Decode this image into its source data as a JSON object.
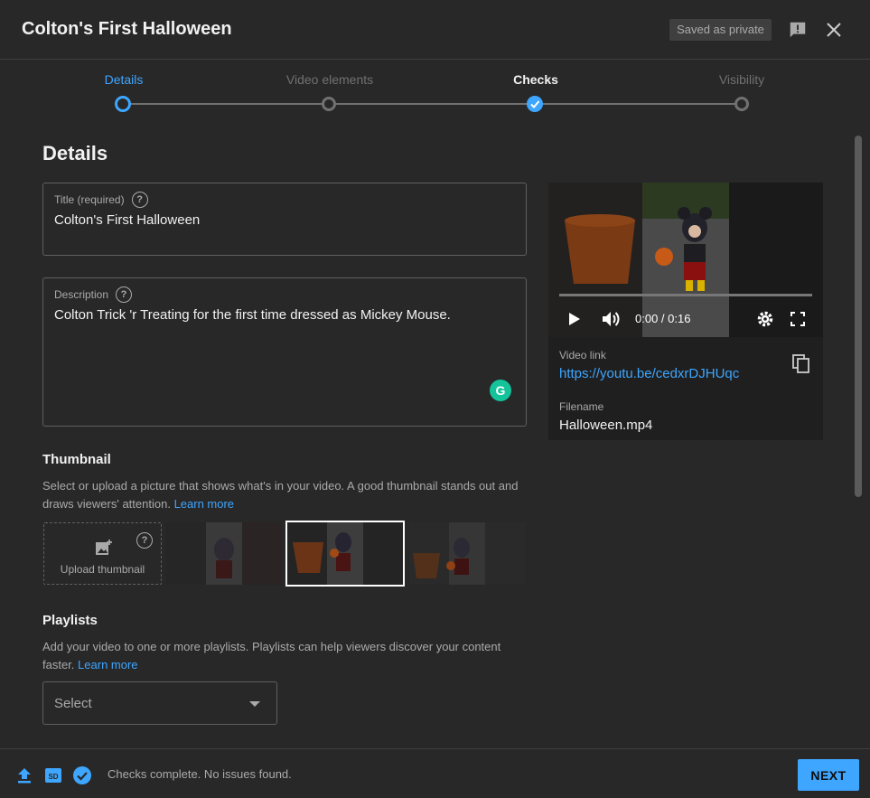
{
  "header": {
    "title": "Colton's First Halloween",
    "saved_badge": "Saved as private"
  },
  "stepper": {
    "steps": [
      {
        "label": "Details",
        "state": "active"
      },
      {
        "label": "Video elements",
        "state": "pending"
      },
      {
        "label": "Checks",
        "state": "done"
      },
      {
        "label": "Visibility",
        "state": "pending"
      }
    ]
  },
  "details": {
    "section_title": "Details",
    "title_field": {
      "label": "Title (required)",
      "value": "Colton's First Halloween"
    },
    "description_field": {
      "label": "Description",
      "value": "Colton Trick 'r Treating for the first time dressed as Mickey Mouse."
    }
  },
  "thumbnail": {
    "heading": "Thumbnail",
    "description": "Select or upload a picture that shows what's in your video. A good thumbnail stands out and draws viewers' attention.",
    "learn_more": "Learn more",
    "upload_label": "Upload thumbnail"
  },
  "playlists": {
    "heading": "Playlists",
    "description": "Add your video to one or more playlists. Playlists can help viewers discover your content faster.",
    "learn_more": "Learn more",
    "select_value": "Select"
  },
  "video": {
    "time": "0:00 / 0:16",
    "link_label": "Video link",
    "link": "https://youtu.be/cedxrDJHUqc",
    "filename_label": "Filename",
    "filename": "Halloween.mp4"
  },
  "footer": {
    "status": "Checks complete. No issues found.",
    "next_label": "NEXT",
    "sd_badge": "SD"
  },
  "colors": {
    "accent": "#3ea6ff",
    "background": "#282828",
    "grammarly": "#15c39a"
  }
}
